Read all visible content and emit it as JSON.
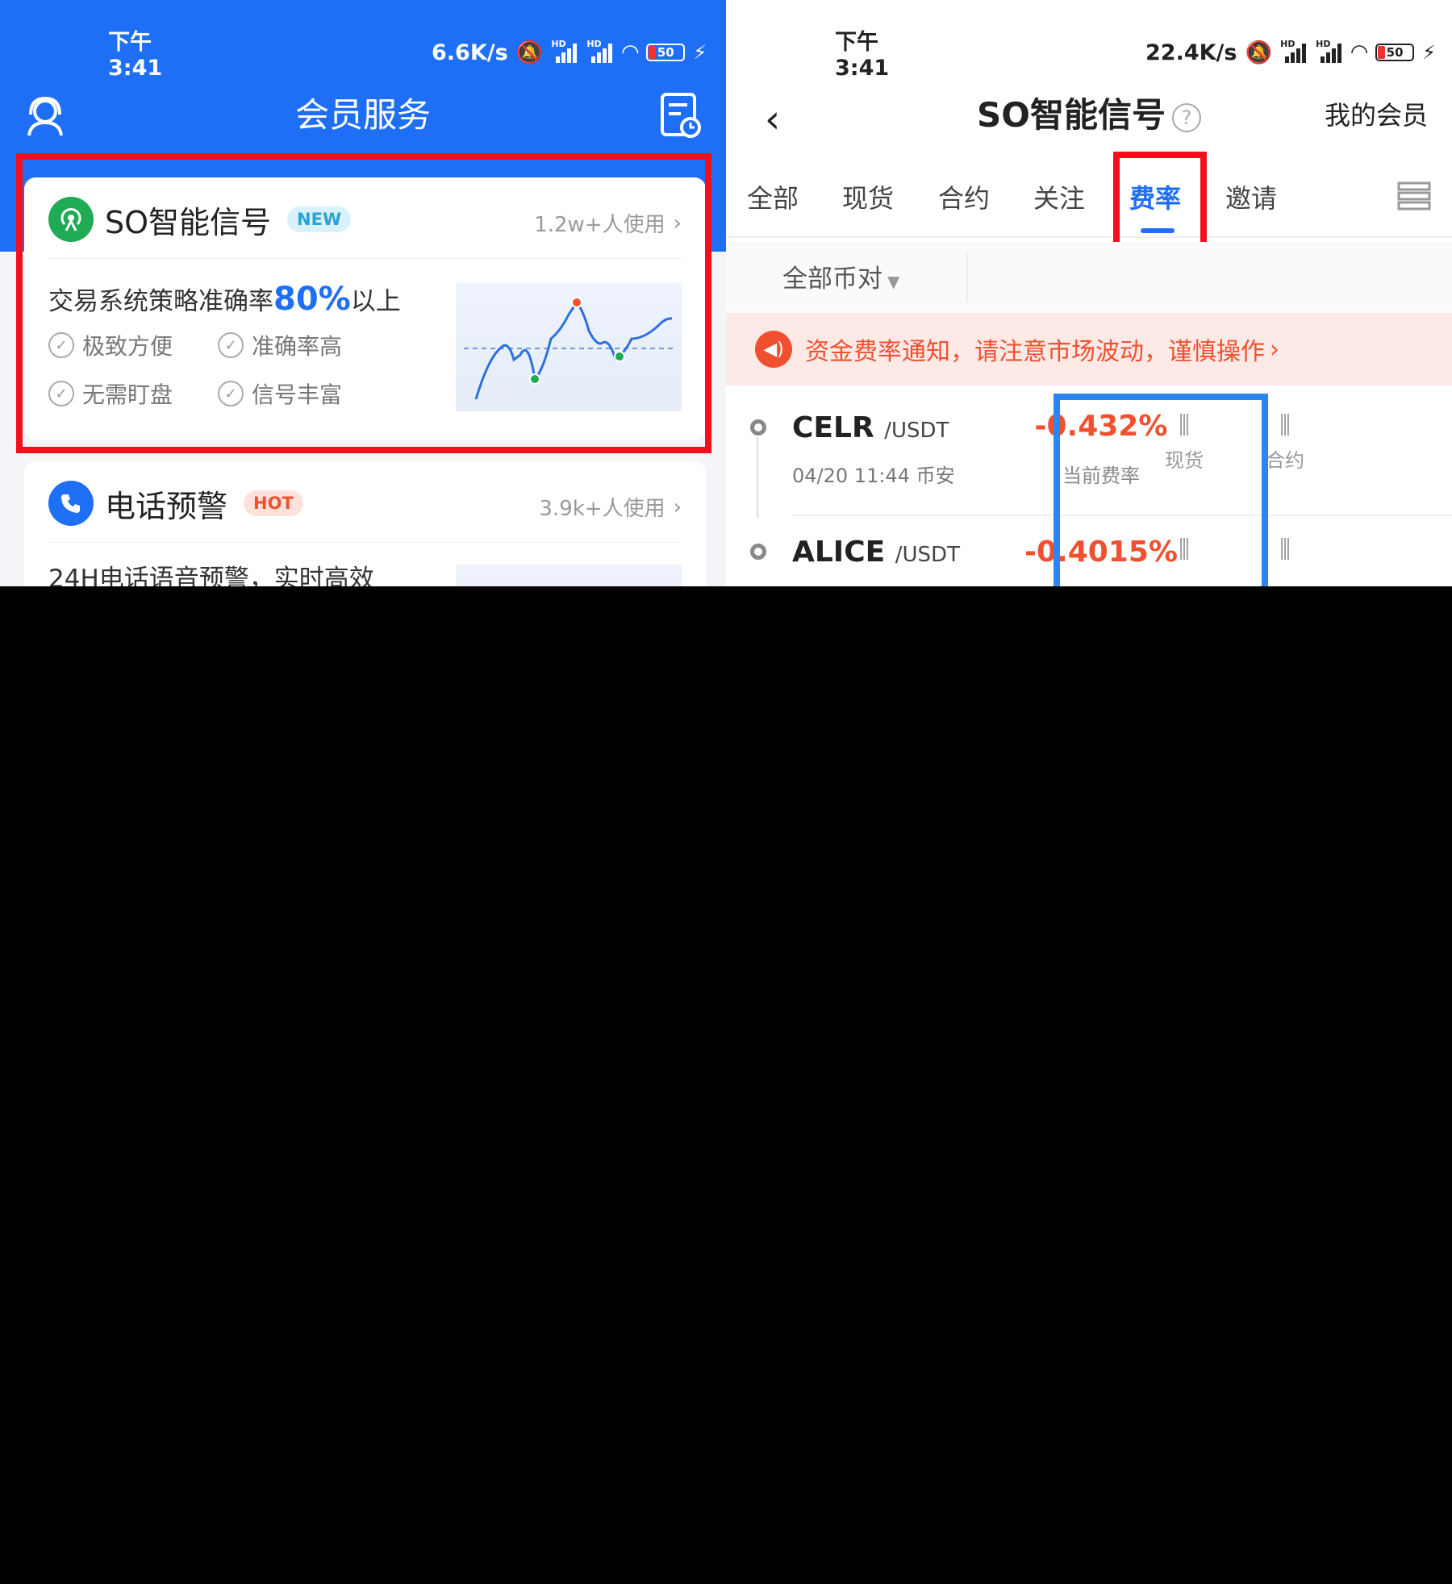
{
  "left": {
    "status": {
      "time": "下午3:41",
      "speed": "6.6K/s",
      "battery": "50"
    },
    "header": {
      "title": "会员服务"
    },
    "card1": {
      "name": "SO智能信号",
      "badge": "NEW",
      "users": "1.2w+人使用",
      "desc_prefix": "交易系统策略准确率",
      "desc_highlight": "80%",
      "desc_suffix": "以上",
      "features": [
        "极致方便",
        "准确率高",
        "无需盯盘",
        "信号丰富"
      ]
    },
    "card2": {
      "name": "电话预警",
      "badge": "HOT",
      "users": "3.9k+人使用",
      "desc": "24H电话语音预警，实时高效"
    }
  },
  "right": {
    "status": {
      "time": "下午3:41",
      "speed": "22.4K/s",
      "battery": "50"
    },
    "header": {
      "title": "SO智能信号",
      "help": "?",
      "my_member": "我的会员"
    },
    "tabs": [
      "全部",
      "现货",
      "合约",
      "关注",
      "费率",
      "邀请"
    ],
    "active_tab": "费率",
    "filter": {
      "label": "全部币对"
    },
    "notice": {
      "text": "资金费率通知，请注意市场波动，谨慎操作"
    },
    "rows": [
      {
        "symbol": "CELR",
        "quote": "/USDT",
        "meta": "04/20 11:44 币安",
        "rate": "-0.432%",
        "rate_label": "当前费率",
        "spot_label": "现货",
        "contract_label": "合约"
      },
      {
        "symbol": "ALICE",
        "quote": "/USDT",
        "rate": "-0.4015%"
      }
    ]
  },
  "colors": {
    "brand_blue": "#1e6ff5",
    "alert_red": "#f05030",
    "highlight_red": "#f0101e",
    "highlight_blue": "#2a86f0"
  },
  "icons": [
    "customer-service-icon",
    "record-icon",
    "radar-icon",
    "phone-icon",
    "back-icon",
    "help-icon",
    "menu-icon",
    "speaker-icon",
    "candlestick-icon"
  ]
}
